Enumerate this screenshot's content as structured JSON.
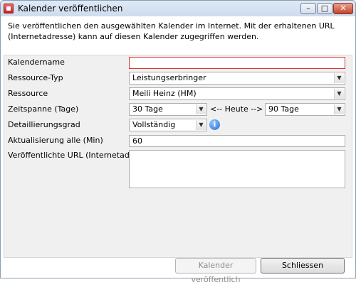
{
  "window": {
    "title": "Kalender veröffentlichen",
    "controls": {
      "minimize": "–",
      "maximize": "□",
      "close": "✕"
    }
  },
  "intro_text": "Sie veröffentlichen den ausgewählten Kalender im Internet. Mit der erhaltenen URL (Internetadresse) kann auf diesen Kalender zugegriffen werden.",
  "form": {
    "kalendername": {
      "label": "Kalendername",
      "value": ""
    },
    "ressource_typ": {
      "label": "Ressource-Typ",
      "value": "Leistungserbringer"
    },
    "ressource": {
      "label": "Ressource",
      "value": "Meili Heinz (HM)"
    },
    "zeitspanne": {
      "label": "Zeitspanne (Tage)",
      "before": "30 Tage",
      "separator": "<-- Heute -->",
      "after": "90 Tage"
    },
    "detaillierungsgrad": {
      "label": "Detaillierungsgrad",
      "value": "Vollständig",
      "info_glyph": "i"
    },
    "aktualisierung": {
      "label": "Aktualisierung alle (Min)",
      "value": "60"
    },
    "url": {
      "label": "Veröffentlichte URL (Internetadresse)",
      "value": ""
    }
  },
  "buttons": {
    "publish": "Kalender veröffentlich",
    "close": "Schliessen"
  },
  "colors": {
    "error_border": "#e03030",
    "title_gradient": "#cddcee"
  },
  "icons": {
    "app": "calendar-app-icon",
    "info": "info-icon",
    "dropdown": "chevron-down-icon"
  }
}
